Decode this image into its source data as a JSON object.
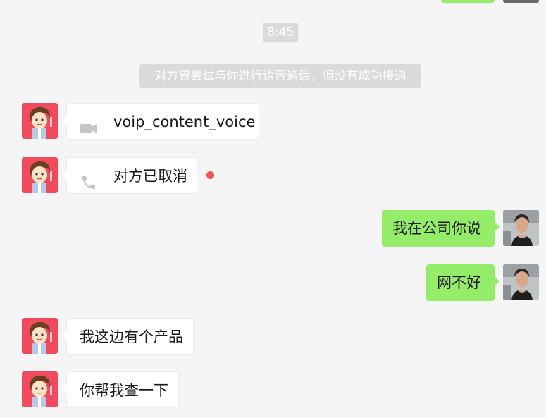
{
  "time_divider": "8:45",
  "system_notice": "对方曾尝试与你进行语音通话，但没有成功接通",
  "messages": [
    {
      "side": "in",
      "type": "video-call",
      "text": "voip_content_voice",
      "icon": "video-camera-icon"
    },
    {
      "side": "in",
      "type": "voice-call",
      "text": "对方已取消",
      "icon": "phone-icon",
      "unread": true
    },
    {
      "side": "out",
      "type": "text",
      "text": "我在公司你说"
    },
    {
      "side": "out",
      "type": "text",
      "text": "网不好"
    },
    {
      "side": "in",
      "type": "text",
      "text": "我这边有个产品"
    },
    {
      "side": "in",
      "type": "text",
      "text": "你帮我查一下"
    }
  ],
  "colors": {
    "background": "#f5f5f5",
    "outgoing_bubble": "#95ec69",
    "incoming_bubble": "#ffffff",
    "system_chip": "#dadada",
    "unread_dot": "#fa5151",
    "contact_avatar_bg": "#f04a5f"
  }
}
